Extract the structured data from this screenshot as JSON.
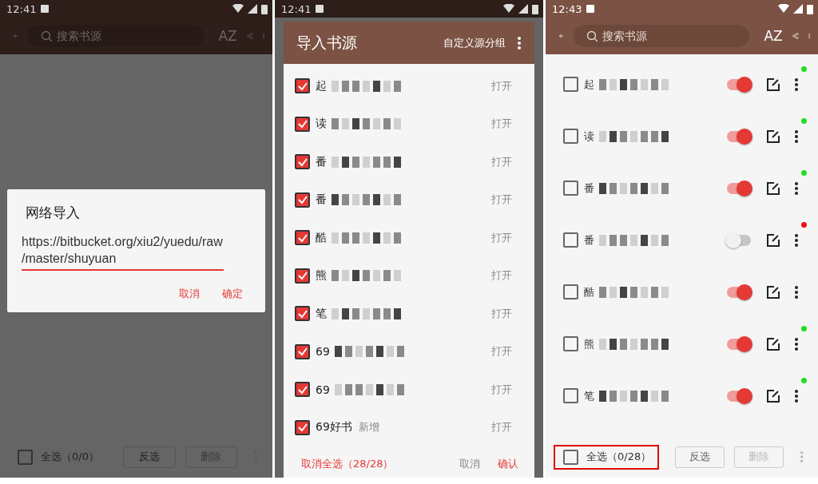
{
  "panels": [
    {
      "kind": "url_import",
      "dimmed": true,
      "status_time": "12:41",
      "toolbar": {
        "search_placeholder": "搜索书源",
        "sort_label": "AZ"
      },
      "dialog": {
        "title": "网络导入",
        "value": "https://bitbucket.org/xiu2/yuedu/raw/master/shuyuan",
        "buttons": [
          "取消",
          "确定"
        ]
      },
      "bottom_bar": {
        "select_all": {
          "label": "全选（0/0）",
          "checked": false,
          "highlighted": false
        },
        "buttons": [
          {
            "label": "反选",
            "disabled": false
          },
          {
            "label": "删除",
            "disabled": true
          }
        ]
      }
    },
    {
      "kind": "source_import",
      "dimmed": true,
      "status_time": "12:41",
      "dialog": {
        "title": "导入书源",
        "group_button": "自定义源分组",
        "rows": [
          {
            "name": "起",
            "checked": true,
            "action": "打开"
          },
          {
            "name": "读",
            "checked": true,
            "action": "打开"
          },
          {
            "name": "番",
            "checked": true,
            "action": "打开"
          },
          {
            "name": "番",
            "checked": true,
            "action": "打开"
          },
          {
            "name": "酷",
            "checked": true,
            "action": "打开"
          },
          {
            "name": "熊",
            "checked": true,
            "action": "打开"
          },
          {
            "name": "笔",
            "checked": true,
            "action": "打开"
          },
          {
            "name": "69",
            "checked": true,
            "action": "打开"
          },
          {
            "name": "69",
            "checked": true,
            "action": "打开"
          },
          {
            "name": "69好书",
            "tag": "新增",
            "checked": true,
            "action": "打开"
          }
        ],
        "deselect_all": "取消全选（28/28）",
        "cancel": "取消",
        "confirm": "确认"
      }
    },
    {
      "kind": "source_list",
      "dimmed": false,
      "status_time": "12:43",
      "toolbar": {
        "search_placeholder": "搜索书源",
        "sort_label": "AZ"
      },
      "rows": [
        {
          "name": "起",
          "checked": false,
          "enabled": true,
          "color": "#22dd22"
        },
        {
          "name": "读",
          "checked": false,
          "enabled": true,
          "color": "#22dd22"
        },
        {
          "name": "番",
          "checked": false,
          "enabled": true,
          "color": "#22dd22"
        },
        {
          "name": "番",
          "checked": false,
          "enabled": false,
          "color": "#ee1111"
        },
        {
          "name": "酷",
          "checked": false,
          "enabled": true
        },
        {
          "name": "熊",
          "checked": false,
          "enabled": true,
          "color": "#22dd22"
        },
        {
          "name": "笔",
          "checked": false,
          "enabled": true,
          "color": "#22dd22"
        }
      ],
      "bottom_bar": {
        "select_all": {
          "label": "全选（0/28）",
          "checked": false,
          "highlighted": true
        },
        "buttons": [
          {
            "label": "反选",
            "disabled": false
          },
          {
            "label": "删除",
            "disabled": true
          }
        ]
      }
    }
  ]
}
